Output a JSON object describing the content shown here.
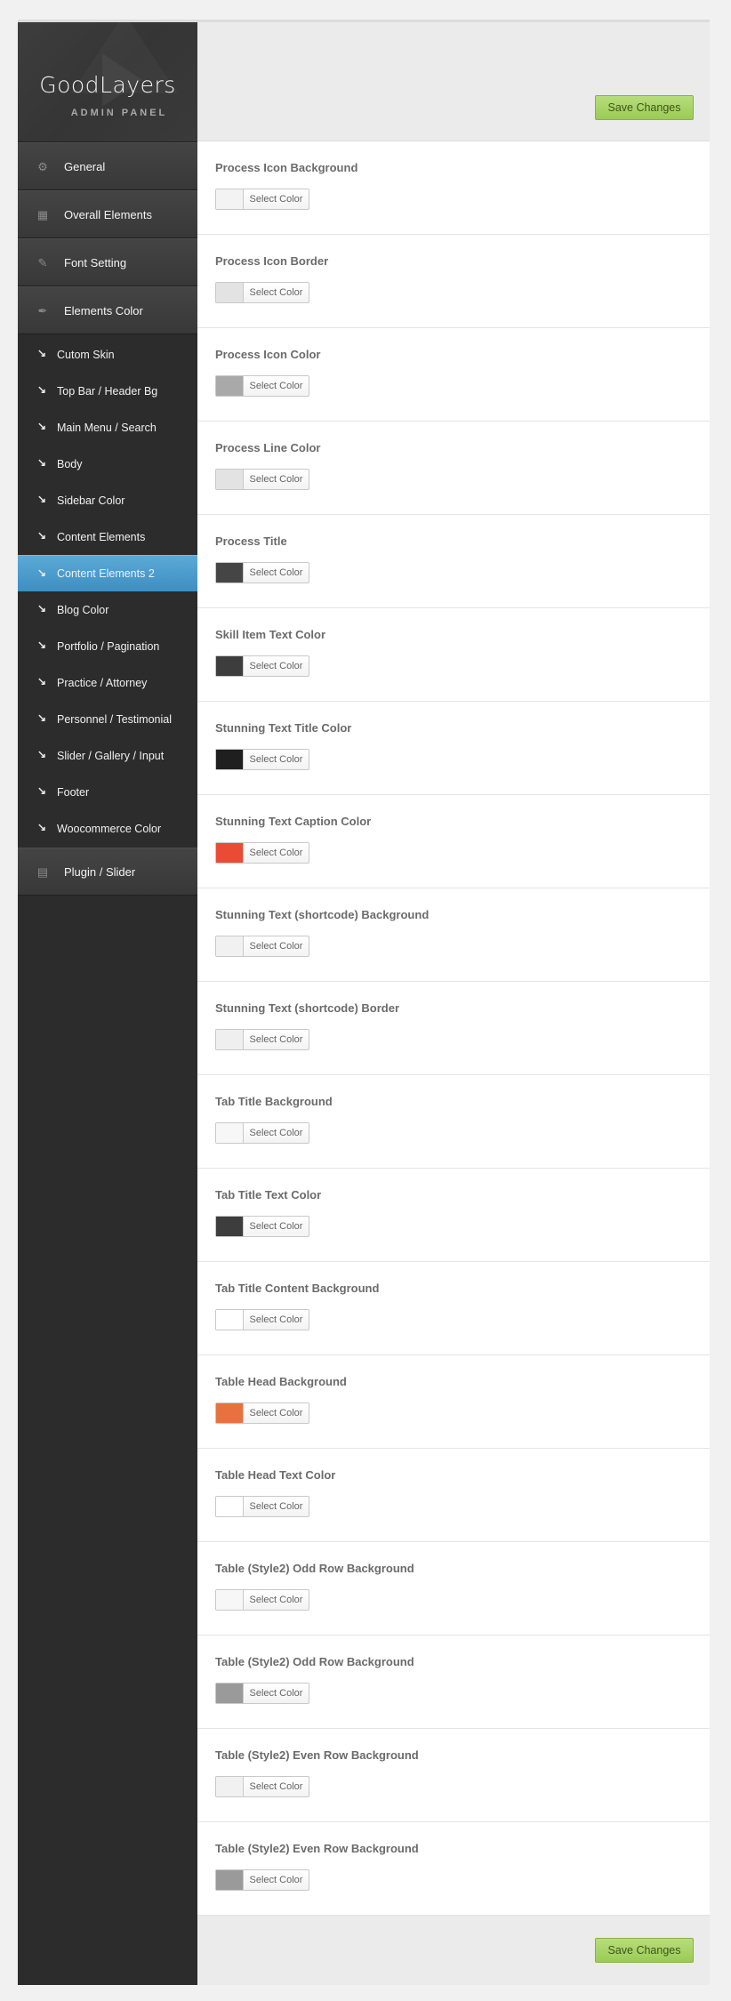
{
  "logo": {
    "title": "GoodLayers",
    "subtitle": "ADMIN PANEL"
  },
  "nav": {
    "main_top": [
      {
        "label": "General",
        "icon": "gear-icon"
      },
      {
        "label": "Overall Elements",
        "icon": "grid-icon"
      },
      {
        "label": "Font Setting",
        "icon": "pencil-icon"
      },
      {
        "label": "Elements Color",
        "icon": "brush-icon"
      }
    ],
    "sub_items": [
      {
        "label": "Cutom Skin",
        "active": false
      },
      {
        "label": "Top Bar / Header Bg",
        "active": false
      },
      {
        "label": "Main Menu / Search",
        "active": false
      },
      {
        "label": "Body",
        "active": false
      },
      {
        "label": "Sidebar Color",
        "active": false
      },
      {
        "label": "Content Elements",
        "active": false
      },
      {
        "label": "Content Elements 2",
        "active": true
      },
      {
        "label": "Blog Color",
        "active": false
      },
      {
        "label": "Portfolio / Pagination",
        "active": false
      },
      {
        "label": "Practice / Attorney",
        "active": false
      },
      {
        "label": "Personnel / Testimonial",
        "active": false
      },
      {
        "label": "Slider / Gallery / Input",
        "active": false
      },
      {
        "label": "Footer",
        "active": false
      },
      {
        "label": "Woocommerce Color",
        "active": false
      }
    ],
    "main_bottom": [
      {
        "label": "Plugin / Slider",
        "icon": "slides-icon"
      }
    ]
  },
  "save_label": "Save Changes",
  "picker_label": "Select Color",
  "options": [
    {
      "label": "Process Icon Background",
      "color": "#f3f3f3"
    },
    {
      "label": "Process Icon Border",
      "color": "#e3e3e3"
    },
    {
      "label": "Process Icon Color",
      "color": "#a9a9a9"
    },
    {
      "label": "Process Line Color",
      "color": "#e3e3e3"
    },
    {
      "label": "Process Title",
      "color": "#454545"
    },
    {
      "label": "Skill Item Text Color",
      "color": "#3d3d3d"
    },
    {
      "label": "Stunning Text Title Color",
      "color": "#1f1f1f"
    },
    {
      "label": "Stunning Text Caption Color",
      "color": "#e94b35"
    },
    {
      "label": "Stunning Text (shortcode) Background",
      "color": "#f1f1f1"
    },
    {
      "label": "Stunning Text (shortcode) Border",
      "color": "#efefef"
    },
    {
      "label": "Tab Title Background",
      "color": "#f7f7f7"
    },
    {
      "label": "Tab Title Text Color",
      "color": "#3d3d3d"
    },
    {
      "label": "Tab Title Content Background",
      "color": "#ffffff"
    },
    {
      "label": "Table Head Background",
      "color": "#e8723f"
    },
    {
      "label": "Table Head Text Color",
      "color": "#ffffff"
    },
    {
      "label": "Table (Style2) Odd Row Background",
      "color": "#f7f7f7"
    },
    {
      "label": "Table (Style2) Odd Row Background",
      "color": "#9a9a9a"
    },
    {
      "label": "Table (Style2) Even Row Background",
      "color": "#f1f1f1"
    },
    {
      "label": "Table (Style2) Even Row Background",
      "color": "#9a9a9a"
    }
  ]
}
